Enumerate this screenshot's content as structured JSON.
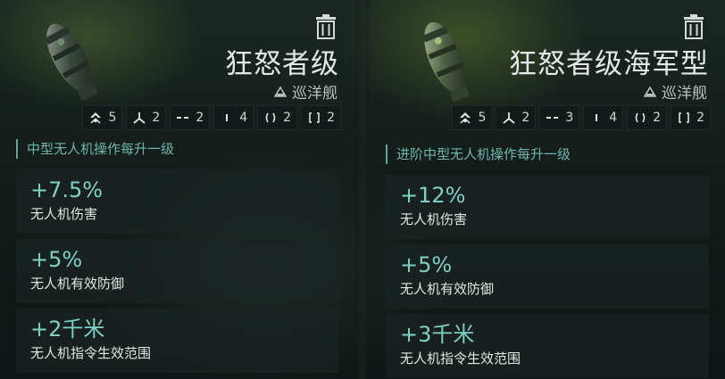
{
  "icons": {
    "delete": "trash-icon",
    "ship_class": "cruiser-class-icon",
    "slots": [
      "drone-bay-icon",
      "fighter-icon",
      "high-slot-icon",
      "mid-slot-icon",
      "low-slot-icon",
      "rig-slot-icon"
    ]
  },
  "colors": {
    "accent": "#6db6ad",
    "bonus_value": "#7fd0c4",
    "panel": "#1a2422"
  },
  "ships": [
    {
      "name": "狂怒者级",
      "class": "巡洋舰",
      "slots": [
        "5",
        "2",
        "2",
        "4",
        "2",
        "2"
      ],
      "skill": "中型无人机操作每升一级",
      "bonuses": [
        {
          "value": "+7.5%",
          "desc": "无人机伤害"
        },
        {
          "value": "+5%",
          "desc": "无人机有效防御"
        },
        {
          "value": "+2千米",
          "desc": "无人机指令生效范围"
        }
      ]
    },
    {
      "name": "狂怒者级海军型",
      "class": "巡洋舰",
      "slots": [
        "5",
        "2",
        "3",
        "4",
        "2",
        "2"
      ],
      "skill": "进阶中型无人机操作每升一级",
      "bonuses": [
        {
          "value": "+12%",
          "desc": "无人机伤害"
        },
        {
          "value": "+5%",
          "desc": "无人机有效防御"
        },
        {
          "value": "+3千米",
          "desc": "无人机指令生效范围"
        }
      ]
    }
  ]
}
